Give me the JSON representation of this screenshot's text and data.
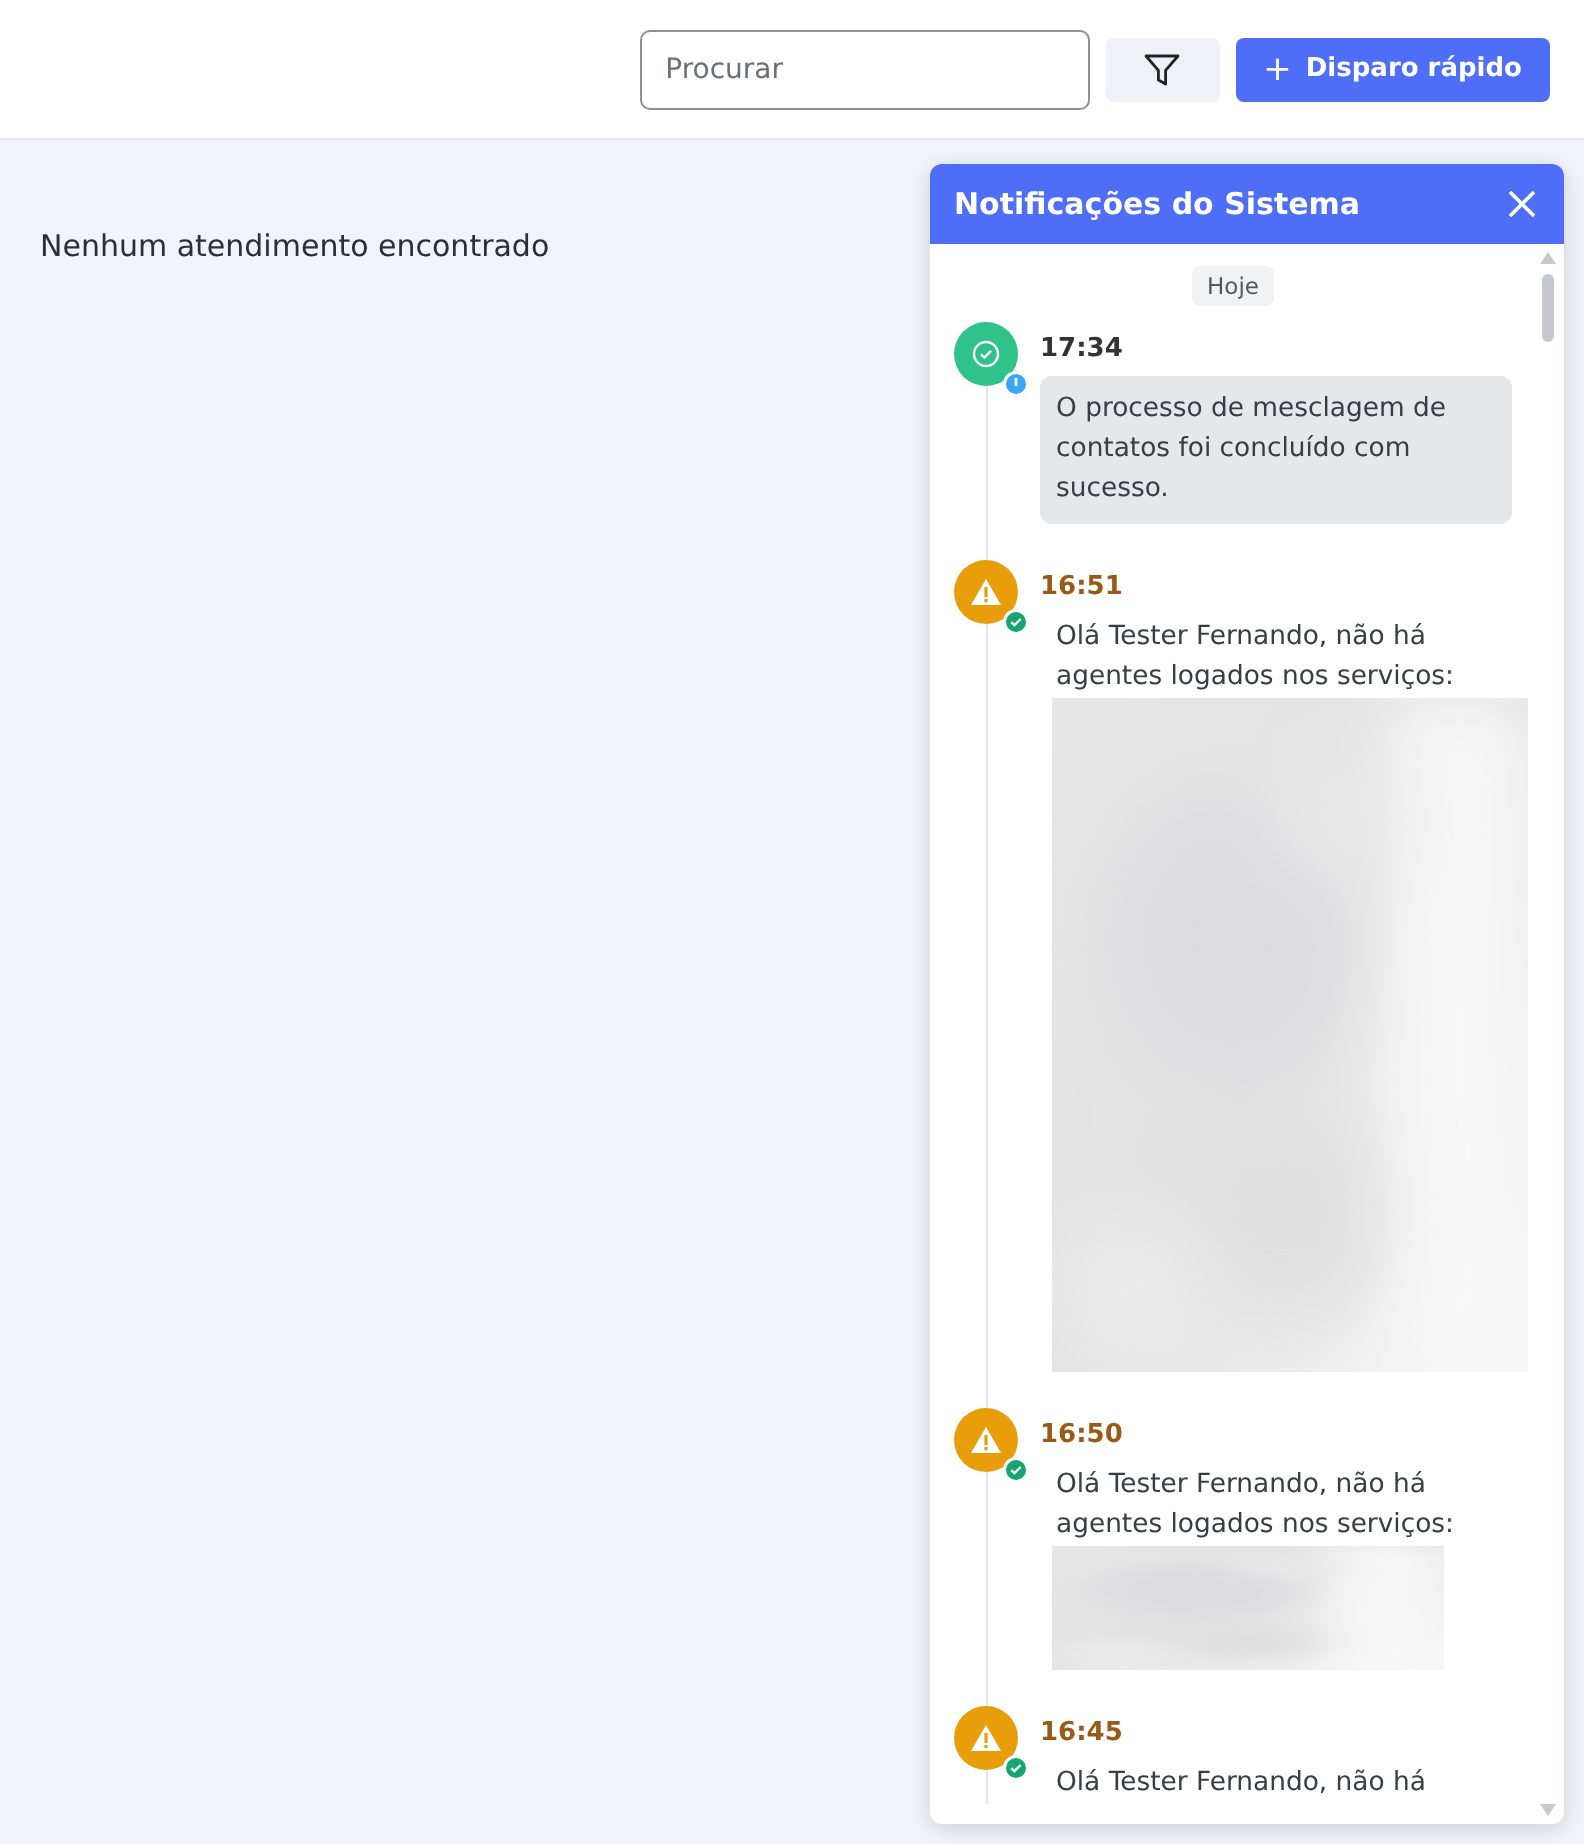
{
  "toolbar": {
    "search": {
      "placeholder": "Procurar"
    },
    "quick_button": {
      "icon": "+",
      "label": "Disparo rápido"
    }
  },
  "content": {
    "empty_message": "Nenhum atendimento encontrado"
  },
  "notifications": {
    "title": "Notificações do Sistema",
    "day": "Hoje",
    "items": [
      {
        "kind": "success",
        "time": "17:34",
        "text": "O processo de mesclagem de contatos foi concluído com sucesso."
      },
      {
        "kind": "warning",
        "time": "16:51",
        "text": "Olá Tester Fernando, não há agentes logados nos serviços:"
      },
      {
        "kind": "warning",
        "time": "16:50",
        "text": "Olá Tester Fernando, não há agentes logados nos serviços:"
      },
      {
        "kind": "warning",
        "time": "16:45",
        "text": "Olá Tester Fernando, não há"
      }
    ]
  }
}
